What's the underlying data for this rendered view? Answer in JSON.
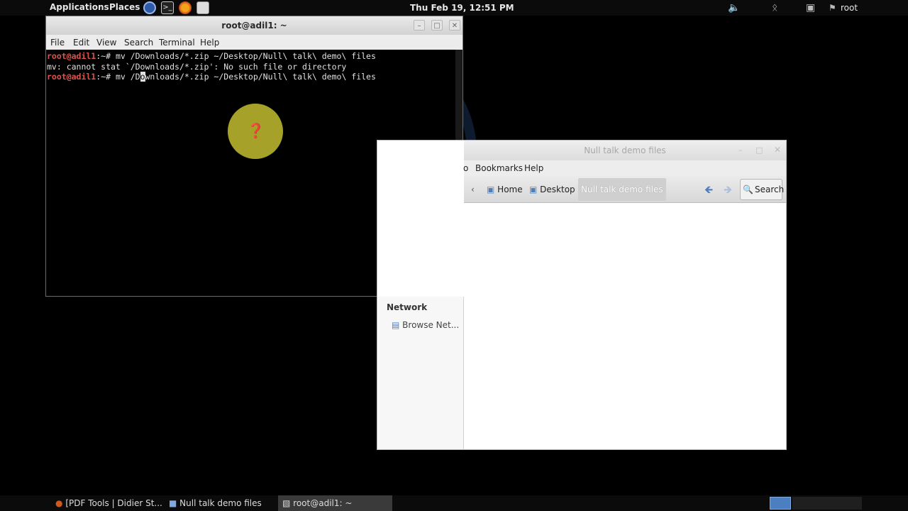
{
  "top_panel": {
    "applications": "Applications",
    "places": "Places",
    "clock": "Thu Feb 19, 12:51 PM",
    "user": "root",
    "icons": [
      "browser-icon",
      "terminal-launcher-icon",
      "firefox-icon",
      "editor-icon",
      "volume-muted-icon",
      "bluetooth-icon",
      "network-icon",
      "user-icon"
    ]
  },
  "terminal": {
    "title": "root@adil1: ~",
    "menu": [
      "File",
      "Edit",
      "View",
      "Search",
      "Terminal",
      "Help"
    ],
    "lines": {
      "l1_prompt": "root@adil1",
      "l1_rest": ":~# mv /Downloads/*.zip ~/Desktop/Null\\ talk\\ demo\\ files",
      "l2": "mv: cannot stat `/Downloads/*.zip': No such file or directory",
      "l3_prompt": "root@adil1",
      "l3_pre": ":~# mv /D",
      "l3_cursor": "o",
      "l3_post": "wnloads/*.zip ~/Desktop/Null\\ talk\\ demo\\ files"
    }
  },
  "file_manager": {
    "title": "Null talk demo files",
    "menu_partial": "o",
    "menu": [
      "Bookmarks",
      "Help"
    ],
    "breadcrumbs": [
      "Home",
      "Desktop",
      "Null talk demo files"
    ],
    "search_label": "Search",
    "sidebar": {
      "heading": "Network",
      "items": [
        "Browse Net..."
      ]
    }
  },
  "taskbar": {
    "tasks": [
      "[PDF Tools | Didier St...",
      "Null talk demo files",
      "root@adil1: ~"
    ]
  },
  "colors": {
    "prompt": "#d9544f",
    "highlight": "#b8b32e",
    "workspace_active": "#4c7fc2"
  }
}
